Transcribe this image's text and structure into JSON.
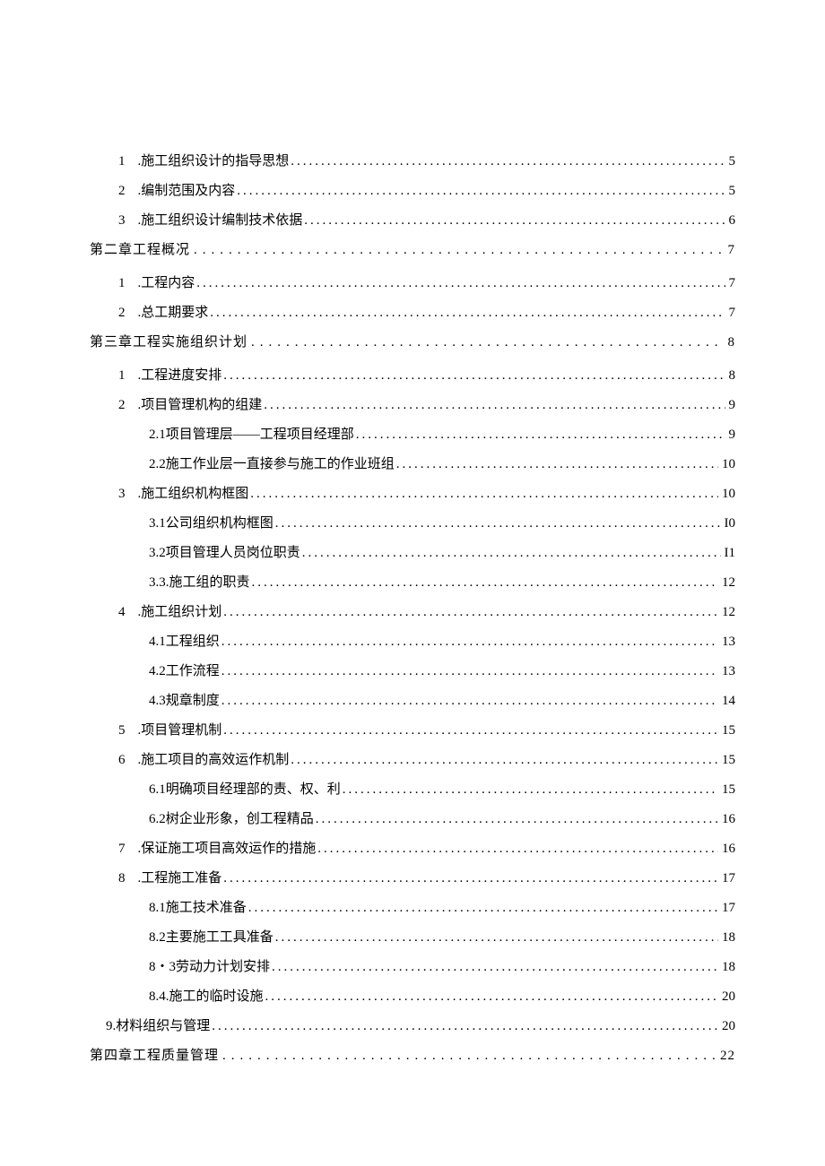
{
  "toc": [
    {
      "level": "level1",
      "num": "1",
      "sep": ".",
      "title": "施工组织设计的指导思想",
      "page": "5",
      "wide": false
    },
    {
      "level": "level1",
      "num": "2",
      "sep": ".",
      "title": "编制范围及内容",
      "page": "5",
      "wide": false
    },
    {
      "level": "level1",
      "num": "3",
      "sep": ".",
      "title": "施工组织设计编制技术依据",
      "page": "6",
      "wide": false
    },
    {
      "level": "level0",
      "num": "",
      "sep": "",
      "title": "第二章工程概况",
      "page": "7",
      "wide": true
    },
    {
      "level": "level1",
      "num": "1",
      "sep": ".",
      "title": "工程内容",
      "page": "7",
      "wide": false
    },
    {
      "level": "level1",
      "num": "2",
      "sep": ".",
      "title": "总工期要求",
      "page": "7",
      "wide": false
    },
    {
      "level": "level0",
      "num": "",
      "sep": "",
      "title": "第三章工程实施组织计划",
      "page": "8",
      "wide": true
    },
    {
      "level": "level1",
      "num": "1",
      "sep": ".",
      "title": "工程进度安排",
      "page": "8",
      "wide": false
    },
    {
      "level": "level1",
      "num": "2",
      "sep": ".",
      "title": "项目管理机构的组建",
      "page": "9",
      "wide": false
    },
    {
      "level": "level2",
      "num": "2.1",
      "sep": "",
      "title": " 项目管理层——工程项目经理部",
      "page": "9",
      "wide": false
    },
    {
      "level": "level2",
      "num": "2.2",
      "sep": "",
      "title": " 施工作业层一直接参与施工的作业班组",
      "page": "10",
      "wide": false
    },
    {
      "level": "level1",
      "num": "3",
      "sep": ".",
      "title": "施工组织机构框图",
      "page": "10",
      "wide": false
    },
    {
      "level": "level2",
      "num": "3.1",
      "sep": "",
      "title": " 公司组织机构框图",
      "page": "I0",
      "wide": false
    },
    {
      "level": "level2",
      "num": "3.2",
      "sep": "",
      "title": " 项目管理人员岗位职责",
      "page": "I1",
      "wide": false
    },
    {
      "level": "level2",
      "num": "3.3",
      "sep": "",
      "title": " .施工组的职责",
      "page": "12",
      "wide": false
    },
    {
      "level": "level1",
      "num": "4",
      "sep": ".",
      "title": "施工组织计划",
      "page": "12",
      "wide": false
    },
    {
      "level": "level2",
      "num": "4.1",
      "sep": "",
      "title": " 工程组织",
      "page": "13",
      "wide": false
    },
    {
      "level": "level2",
      "num": "4.2",
      "sep": "",
      "title": " 工作流程",
      "page": "13",
      "wide": false
    },
    {
      "level": "level2",
      "num": "4.3",
      "sep": "",
      "title": " 规章制度",
      "page": "14",
      "wide": false
    },
    {
      "level": "level1",
      "num": "5",
      "sep": ".",
      "title": "项目管理机制",
      "page": "15",
      "wide": false
    },
    {
      "level": "level1",
      "num": "6",
      "sep": ".",
      "title": "施工项目的高效运作机制",
      "page": "15",
      "wide": false
    },
    {
      "level": "level2",
      "num": "6.1",
      "sep": "",
      "title": " 明确项目经理部的责、权、利",
      "page": "15",
      "wide": false
    },
    {
      "level": "level2",
      "num": "6.2",
      "sep": "",
      "title": " 树企业形象，创工程精品",
      "page": "16",
      "wide": false
    },
    {
      "level": "level1",
      "num": "7",
      "sep": ".",
      "title": "保证施工项目高效运作的措施",
      "page": "16",
      "wide": false
    },
    {
      "level": "level1",
      "num": "8",
      "sep": ".",
      "title": "工程施工准备",
      "page": "17",
      "wide": false
    },
    {
      "level": "level2",
      "num": "8.1",
      "sep": "",
      "title": " 施工技术准备",
      "page": "17",
      "wide": false
    },
    {
      "level": "level2",
      "num": "8.2",
      "sep": "",
      "title": " 主要施工工具准备",
      "page": "18",
      "wide": false
    },
    {
      "level": "level2",
      "num": "8・3",
      "sep": "",
      "title": " 劳动力计划安排",
      "page": "18",
      "wide": false
    },
    {
      "level": "level2",
      "num": "8.4.",
      "sep": "",
      "title": "施工的临时设施",
      "page": "20",
      "wide": false
    },
    {
      "level": "level1b",
      "num": "9.",
      "sep": "",
      "title": "材料组织与管理",
      "page": "20",
      "wide": false
    },
    {
      "level": "level0",
      "num": "",
      "sep": "",
      "title": "第四章工程质量管理",
      "page": "22",
      "wide": true
    }
  ]
}
